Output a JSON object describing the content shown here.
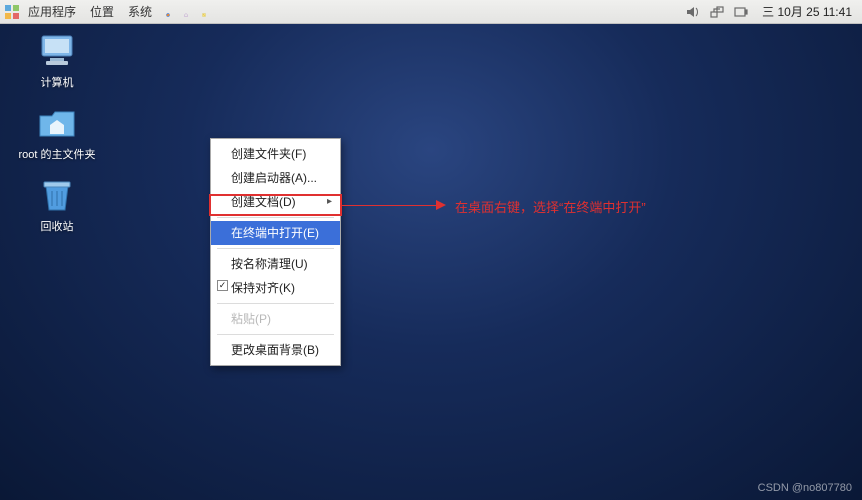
{
  "panel": {
    "apps": "应用程序",
    "places": "位置",
    "system": "系统",
    "clock": "三 10月 25 11:41"
  },
  "desktop": {
    "computer": "计算机",
    "home": "root 的主文件夹",
    "trash": "回收站"
  },
  "ctx": {
    "create_folder": "创建文件夹(F)",
    "create_launcher": "创建启动器(A)...",
    "create_doc": "创建文档(D)",
    "open_terminal": "在终端中打开(E)",
    "cleanup_name": "按名称清理(U)",
    "keep_aligned": "保持对齐(K)",
    "paste": "粘贴(P)",
    "change_bg": "更改桌面背景(B)"
  },
  "annotation": "在桌面右键，选择“在终端中打开”",
  "watermark": "CSDN @no807780"
}
